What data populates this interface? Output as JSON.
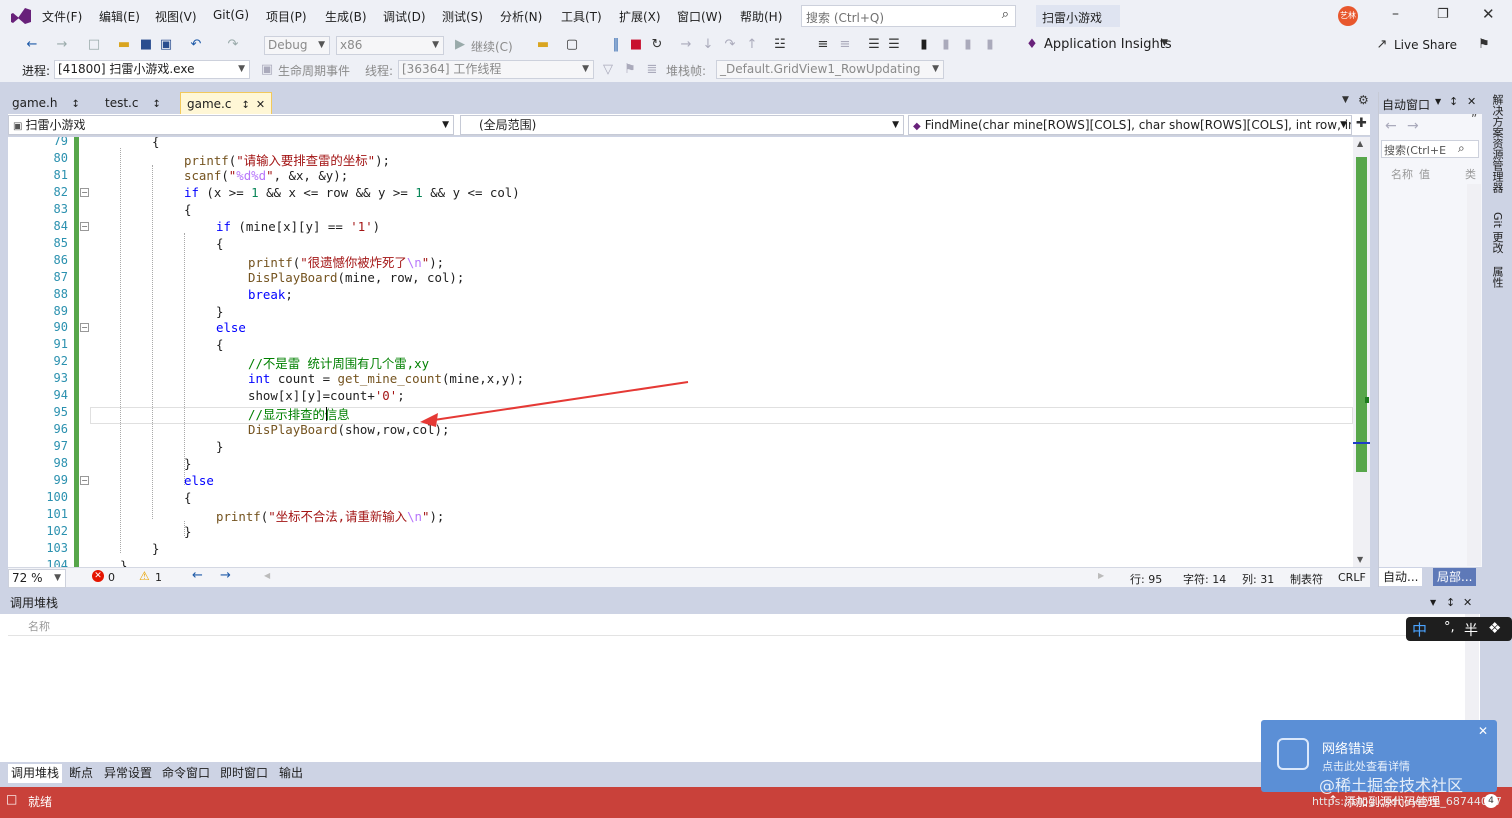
{
  "menu": {
    "items": [
      "文件(F)",
      "编辑(E)",
      "视图(V)",
      "Git(G)",
      "项目(P)",
      "生成(B)",
      "调试(D)",
      "测试(S)",
      "分析(N)",
      "工具(T)",
      "扩展(X)",
      "窗口(W)",
      "帮助(H)"
    ],
    "search_placeholder": "搜索 (Ctrl+Q)",
    "solution_title": "扫雷小游戏",
    "avatar": "艺林"
  },
  "toolbar": {
    "config": "Debug",
    "platform": "x86",
    "continue_label": "继续(C)",
    "app_insights": "Application Insights",
    "live_share": "Live Share"
  },
  "debugbar": {
    "process_label": "进程:",
    "process_value": "[41800] 扫雷小游戏.exe",
    "lifecycle_label": "生命周期事件",
    "thread_label": "线程:",
    "thread_value": "[36364] 工作线程",
    "stackframe_label": "堆栈帧:",
    "stackframe_value": "_Default.GridView1_RowUpdating"
  },
  "tabs": [
    "game.h",
    "test.c",
    "game.c"
  ],
  "nav": {
    "project": "扫雷小游戏",
    "scope": "(全局范围)",
    "member": "FindMine(char mine[ROWS][COLS], char show[ROWS][COLS], int row, int"
  },
  "code": {
    "line_numbers": [
      "79",
      "80",
      "81",
      "82",
      "83",
      "84",
      "85",
      "86",
      "87",
      "88",
      "89",
      "90",
      "91",
      "92",
      "93",
      "94",
      "95",
      "96",
      "97",
      "98",
      "99",
      "100",
      "101",
      "102",
      "103",
      "104"
    ],
    "lines": [
      "{",
      "printf(\"请输入要排查雷的坐标\");",
      "scanf(\"%d%d\", &x, &y);",
      "if (x >= 1 && x <= row && y >= 1 && y <= col)",
      "{",
      "if (mine[x][y] == '1')",
      "{",
      "printf(\"很遗憾你被炸死了\\n\");",
      "DisPlayBoard(mine, row, col);",
      "break;",
      "}",
      "else",
      "{",
      "//不是雷 统计周围有几个雷,xy",
      "int count = get_mine_count(mine,x,y);",
      "show[x][y]=count+'0';",
      "//显示排查的信息",
      "DisPlayBoard(show,row,col);",
      "}",
      "}",
      "else",
      "{",
      "printf(\"坐标不合法,请重新输入\\n\");",
      "}",
      "}",
      "}"
    ]
  },
  "status": {
    "zoom": "72 %",
    "errors": "0",
    "warnings": "1",
    "row": "行: 95",
    "char": "字符: 14",
    "col": "列: 31",
    "tabs": "制表符",
    "eol": "CRLF"
  },
  "right_panel": {
    "title": "自动窗口",
    "search": "搜索(Ctrl+E",
    "col_name": "名称",
    "col_value": "值",
    "col_type": "类",
    "tab_auto": "自动...",
    "tab_local": "局部...",
    "strip": [
      "解决方案资源管理器",
      "Git 更改",
      "属性"
    ]
  },
  "callstack": {
    "title": "调用堆栈",
    "col_name": "名称"
  },
  "bottom_tabs": [
    "调用堆栈",
    "断点",
    "异常设置",
    "命令窗口",
    "即时窗口",
    "输出"
  ],
  "statusbar": {
    "ready": "就绪",
    "add_source": "添加到源代码管理"
  },
  "toast": {
    "title": "网络错误",
    "body": "点击此处查看详情"
  },
  "watermark": {
    "site": "@稀土掘金技术社区",
    "url": "https://blog.csdn.net/m_68744027"
  },
  "ime": {
    "mode": "中",
    "punct": "°,",
    "width": "半"
  },
  "colors": {
    "accent": "#68217a",
    "status_red": "#c9413a",
    "toast_blue": "#5b8fd6",
    "change_green": "#57a64a",
    "annotation_arrow": "#e53935"
  }
}
